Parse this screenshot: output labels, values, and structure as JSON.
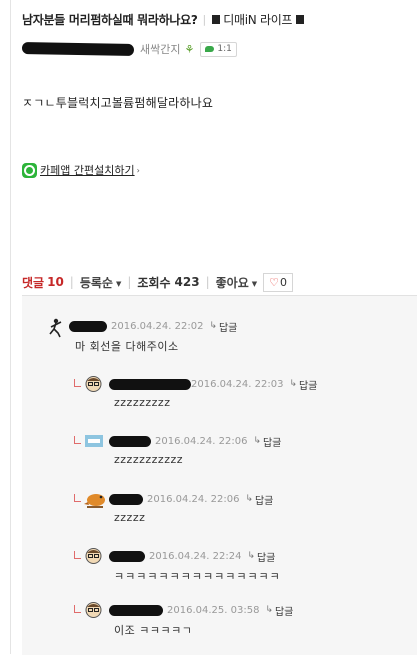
{
  "post": {
    "title": "남자분들 머리펌하실때 뭐라하나요?",
    "category": "디매iN 라이프",
    "author_level": "새싹간지",
    "chat_badge": "1:1",
    "body": "ㅈㄱㄴ투블럭치고볼륨펌해달라하나요",
    "cafe_app_link": "카페앱 간편설치하기",
    "cafe_app_arrow": "›"
  },
  "comment_bar": {
    "label": "댓글",
    "count": "10",
    "sort": "등록순",
    "views_label": "조회수",
    "views": "423",
    "like_label": "좋아요",
    "like_count": "0",
    "like_heart": "♡"
  },
  "comments": [
    {
      "date": "2016.04.24. 22:02",
      "reply": "답글",
      "text": "마 회선을 다해주이소",
      "avatar": "stick-figure-avatar"
    },
    {
      "date": "2016.04.24. 22:03",
      "reply": "답글",
      "text": "zzzzzzzzz",
      "avatar": "face-glasses-avatar"
    },
    {
      "date": "2016.04.24. 22:06",
      "reply": "답글",
      "text": "zzzzzzzzzzz",
      "avatar": "badge-avatar"
    },
    {
      "date": "2016.04.24. 22:06",
      "reply": "답글",
      "text": "zzzzz",
      "avatar": "bird-avatar"
    },
    {
      "date": "2016.04.24. 22:24",
      "reply": "답글",
      "text": "ㅋㅋㅋㅋㅋㅋㅋㅋㅋㅋㅋㅋㅋㅋㅋ",
      "avatar": "face-glasses-avatar"
    },
    {
      "date": "2016.04.25. 03:58",
      "reply": "답글",
      "text": "이조 ㅋㅋㅋㅋㄱ",
      "avatar": "face-glasses-avatar"
    }
  ],
  "icons": {
    "reply_arrow": "↳",
    "caret": "▼"
  },
  "colors": {
    "comment_count": "#c62828",
    "cafe_green": "#2db43a",
    "reply_mark": "#e06b6b",
    "comments_bg": "#f6f6f6"
  }
}
